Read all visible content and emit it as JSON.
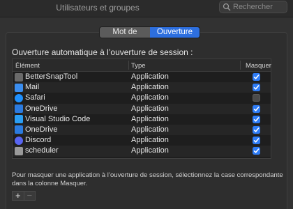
{
  "window": {
    "title": "Utilisateurs et groupes"
  },
  "search": {
    "placeholder": "Rechercher"
  },
  "tabs": [
    {
      "label": "Mot de passe",
      "active": false
    },
    {
      "label": "Ouverture",
      "active": true
    }
  ],
  "section": {
    "label": "Ouverture automatique à l’ouverture de session :"
  },
  "table": {
    "headers": {
      "element": "Élément",
      "type": "Type",
      "hide": "Masquer"
    },
    "rows": [
      {
        "name": "BetterSnapTool",
        "type": "Application",
        "hidden": true,
        "icon": "bettersnaptool-icon",
        "color": "#6a6a6a"
      },
      {
        "name": "Mail",
        "type": "Application",
        "hidden": true,
        "icon": "mail-icon",
        "color": "#3b8ef0"
      },
      {
        "name": "Safari",
        "type": "Application",
        "hidden": false,
        "icon": "safari-icon",
        "color": "#1e90ff"
      },
      {
        "name": "OneDrive",
        "type": "Application",
        "hidden": true,
        "icon": "onedrive-icon",
        "color": "#2b7be0"
      },
      {
        "name": "Visual Studio Code",
        "type": "Application",
        "hidden": true,
        "icon": "vscode-icon",
        "color": "#2a9ef4"
      },
      {
        "name": "OneDrive",
        "type": "Application",
        "hidden": true,
        "icon": "onedrive-icon",
        "color": "#2b7be0"
      },
      {
        "name": "Discord",
        "type": "Application",
        "hidden": true,
        "icon": "discord-icon",
        "color": "#5865f2"
      },
      {
        "name": "scheduler",
        "type": "Application",
        "hidden": true,
        "icon": "scheduler-icon",
        "color": "#9a9a9a"
      }
    ]
  },
  "footnote": "Pour masquer une application à l’ouverture de session, sélectionnez la case correspondante dans la colonne Masquer.",
  "buttons": {
    "add": "+",
    "remove": "−"
  },
  "colors": {
    "accent": "#2e7cf6",
    "background": "#323232"
  }
}
